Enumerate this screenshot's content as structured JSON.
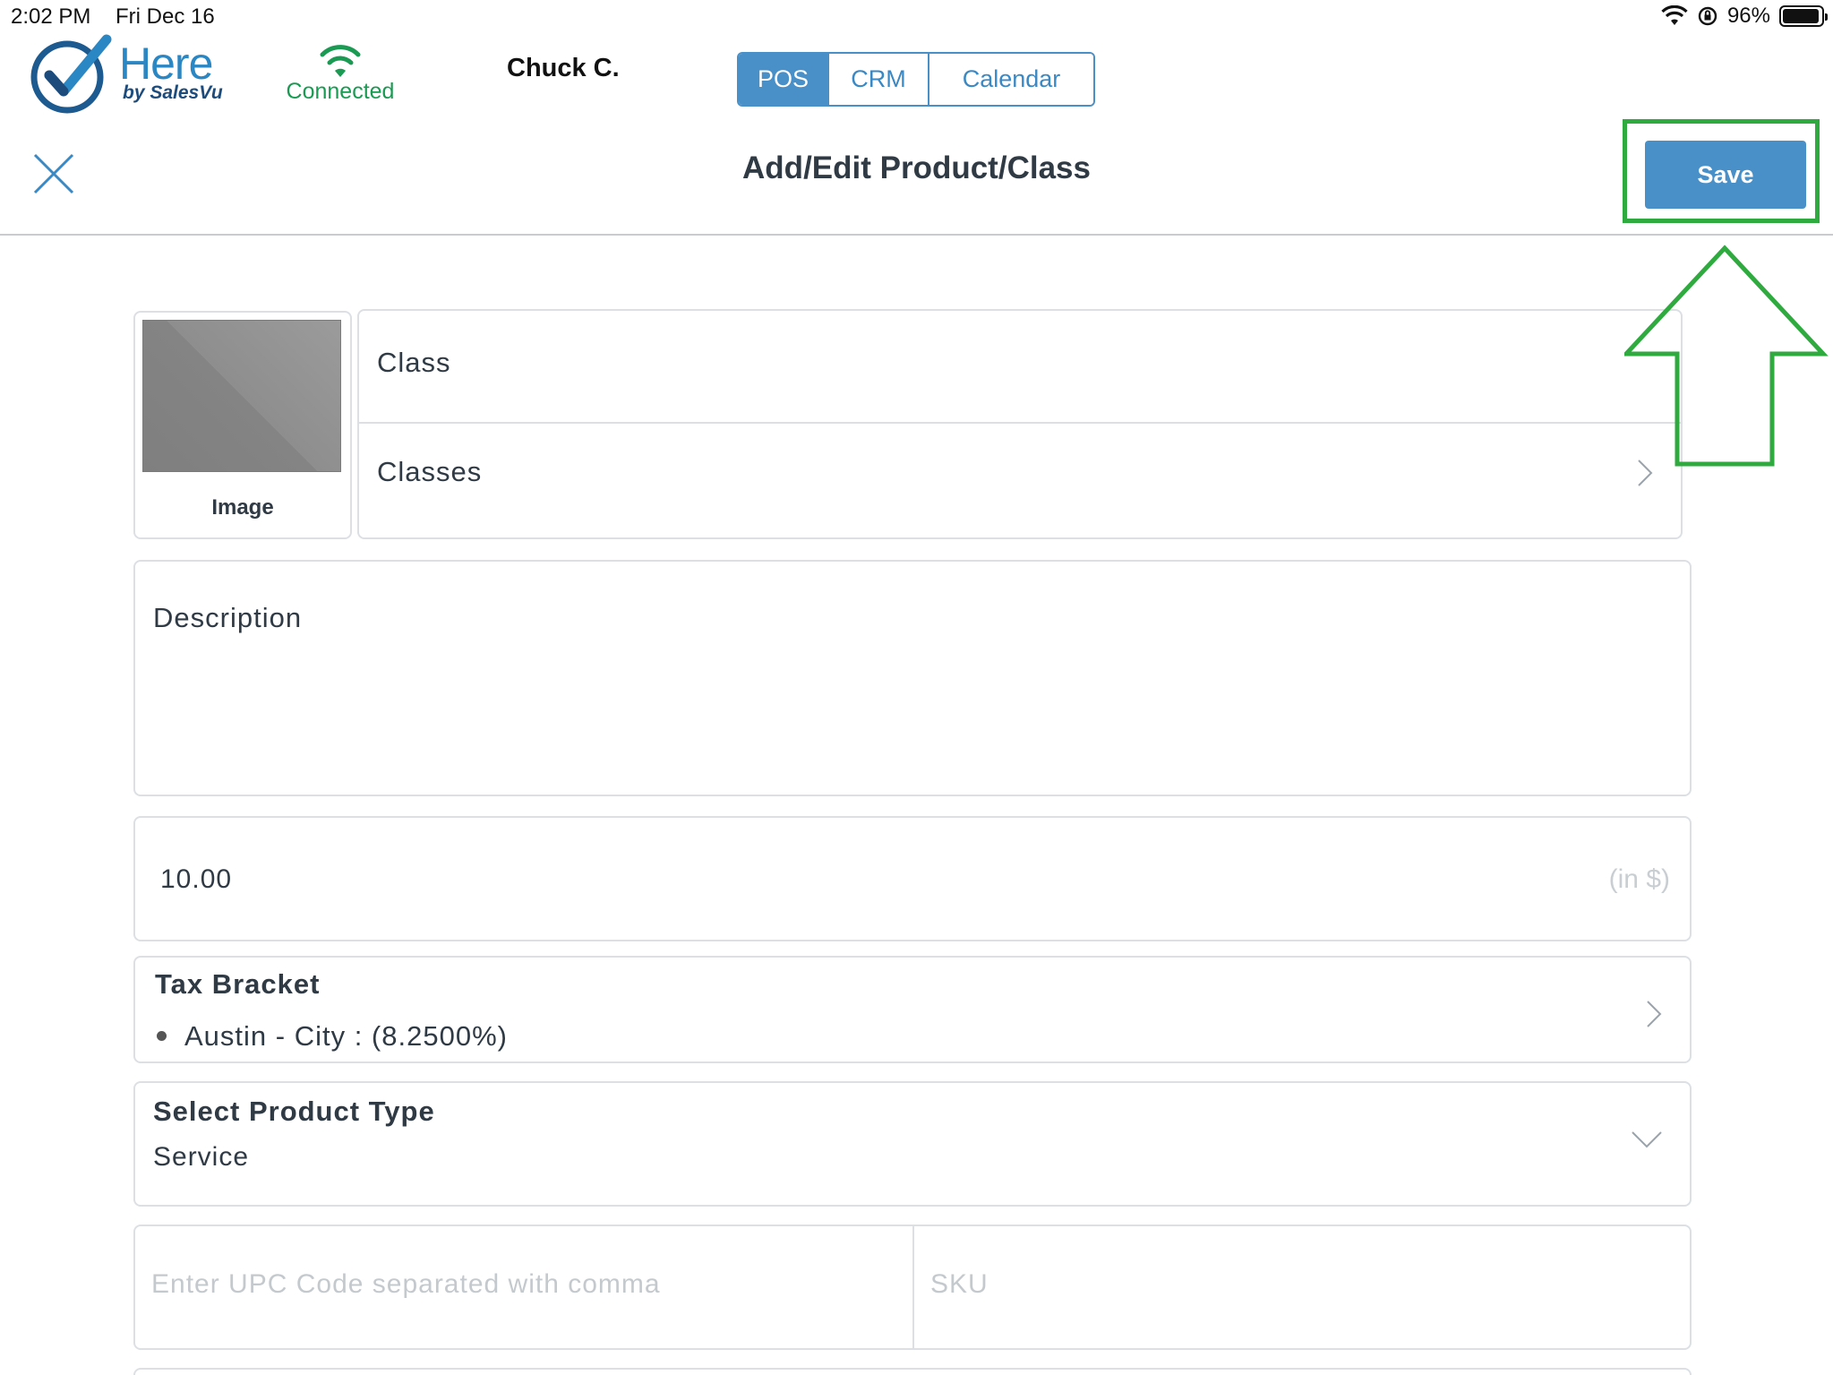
{
  "status_bar": {
    "time": "2:02 PM",
    "date": "Fri Dec 16",
    "battery": "96%",
    "battery_level": 0.96
  },
  "header": {
    "logo_main": "Here",
    "logo_sub": "by SalesVu",
    "connection_status": "Connected",
    "user_name": "Chuck C.",
    "tabs": [
      {
        "label": "POS",
        "active": true
      },
      {
        "label": "CRM",
        "active": false
      },
      {
        "label": "Calendar",
        "active": false
      }
    ]
  },
  "toolbar": {
    "title": "Add/Edit Product/Class",
    "save_label": "Save"
  },
  "form": {
    "image_label": "Image",
    "name_value": "Class",
    "classes_label": "Classes",
    "description_placeholder": "Description",
    "price_value": "10.00",
    "price_unit": "(in $)",
    "tax_bracket_title": "Tax Bracket",
    "tax_bracket_value": "Austin - City : (8.2500%)",
    "product_type_title": "Select Product Type",
    "product_type_value": "Service",
    "upc_placeholder": "Enter UPC Code separated with comma",
    "sku_placeholder": "SKU"
  },
  "colors": {
    "accent": "#4a90c8",
    "connected": "#1a9a52",
    "annotation": "#2eaa3f"
  },
  "icons": [
    "close-icon",
    "wifi-icon",
    "chevron-right-icon",
    "chevron-down-icon",
    "check-logo-icon"
  ]
}
